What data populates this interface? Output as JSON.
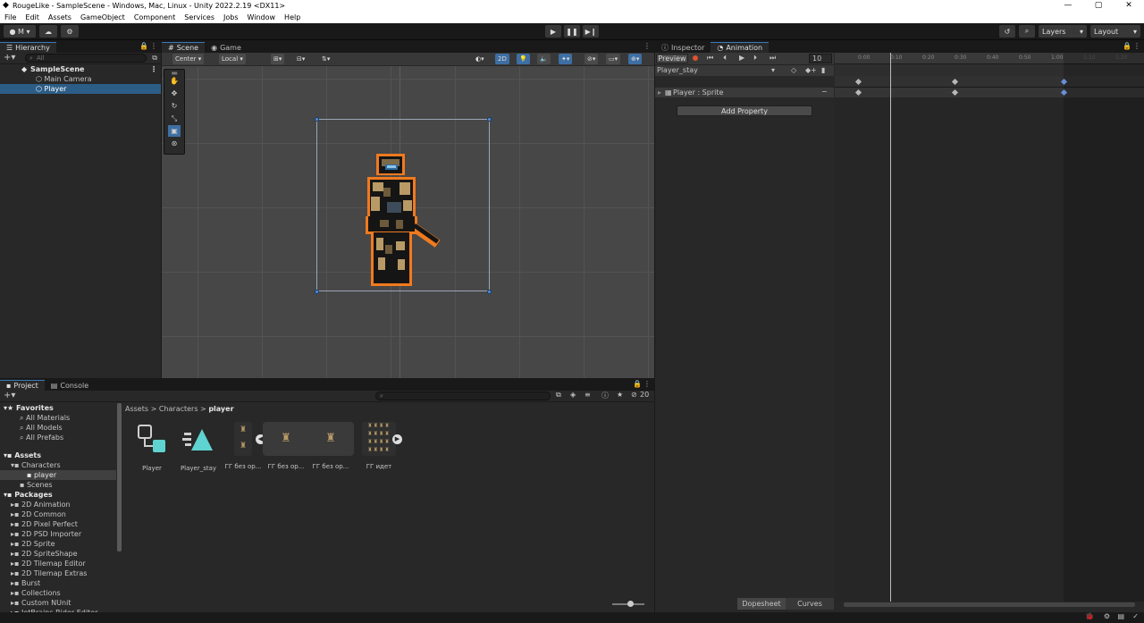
{
  "window": {
    "title": "RougeLike - SampleScene - Windows, Mac, Linux - Unity 2022.2.19 <DX11>"
  },
  "menu": [
    "File",
    "Edit",
    "Assets",
    "GameObject",
    "Component",
    "Services",
    "Jobs",
    "Window",
    "Help"
  ],
  "toolbar": {
    "account": "M",
    "layers": "Layers",
    "layout": "Layout"
  },
  "hierarchy": {
    "tab": "Hierarchy",
    "search_placeholder": "All",
    "scene": "SampleScene",
    "items": [
      "Main Camera",
      "Player"
    ],
    "selected": "Player"
  },
  "scene_view": {
    "tabs": [
      "Scene",
      "Game"
    ],
    "pivot": "Center",
    "space": "Local",
    "mode_2d": "2D"
  },
  "project": {
    "tabs": [
      "Project",
      "Console"
    ],
    "favorites_label": "Favorites",
    "favorites": [
      "All Materials",
      "All Models",
      "All Prefabs"
    ],
    "assets_label": "Assets",
    "assets_tree": [
      "Characters",
      "player",
      "Scenes"
    ],
    "packages_label": "Packages",
    "packages": [
      "2D Animation",
      "2D Common",
      "2D Pixel Perfect",
      "2D PSD Importer",
      "2D Sprite",
      "2D SpriteShape",
      "2D Tilemap Editor",
      "2D Tilemap Extras",
      "Burst",
      "Collections",
      "Custom NUnit",
      "JetBrains Rider Editor"
    ],
    "breadcrumb": [
      "Assets",
      "Characters",
      "player"
    ],
    "search_count": "20",
    "files": [
      "Player",
      "Player_stay",
      "ГГ без ор...",
      "ГГ без ор...",
      "ГГ без ор...",
      "ГГ идет"
    ]
  },
  "inspector": {
    "tabs": [
      "Inspector",
      "Animation"
    ]
  },
  "animation": {
    "preview": "Preview",
    "frame": "10",
    "clip": "Player_stay",
    "property": "Player : Sprite",
    "add_property": "Add Property",
    "ruler": [
      "0:00",
      "0:10",
      "0:20",
      "0:30",
      "0:40",
      "0:50",
      "1:00",
      "1:10",
      "1:20"
    ],
    "dopesheet": "Dopesheet",
    "curves": "Curves"
  }
}
